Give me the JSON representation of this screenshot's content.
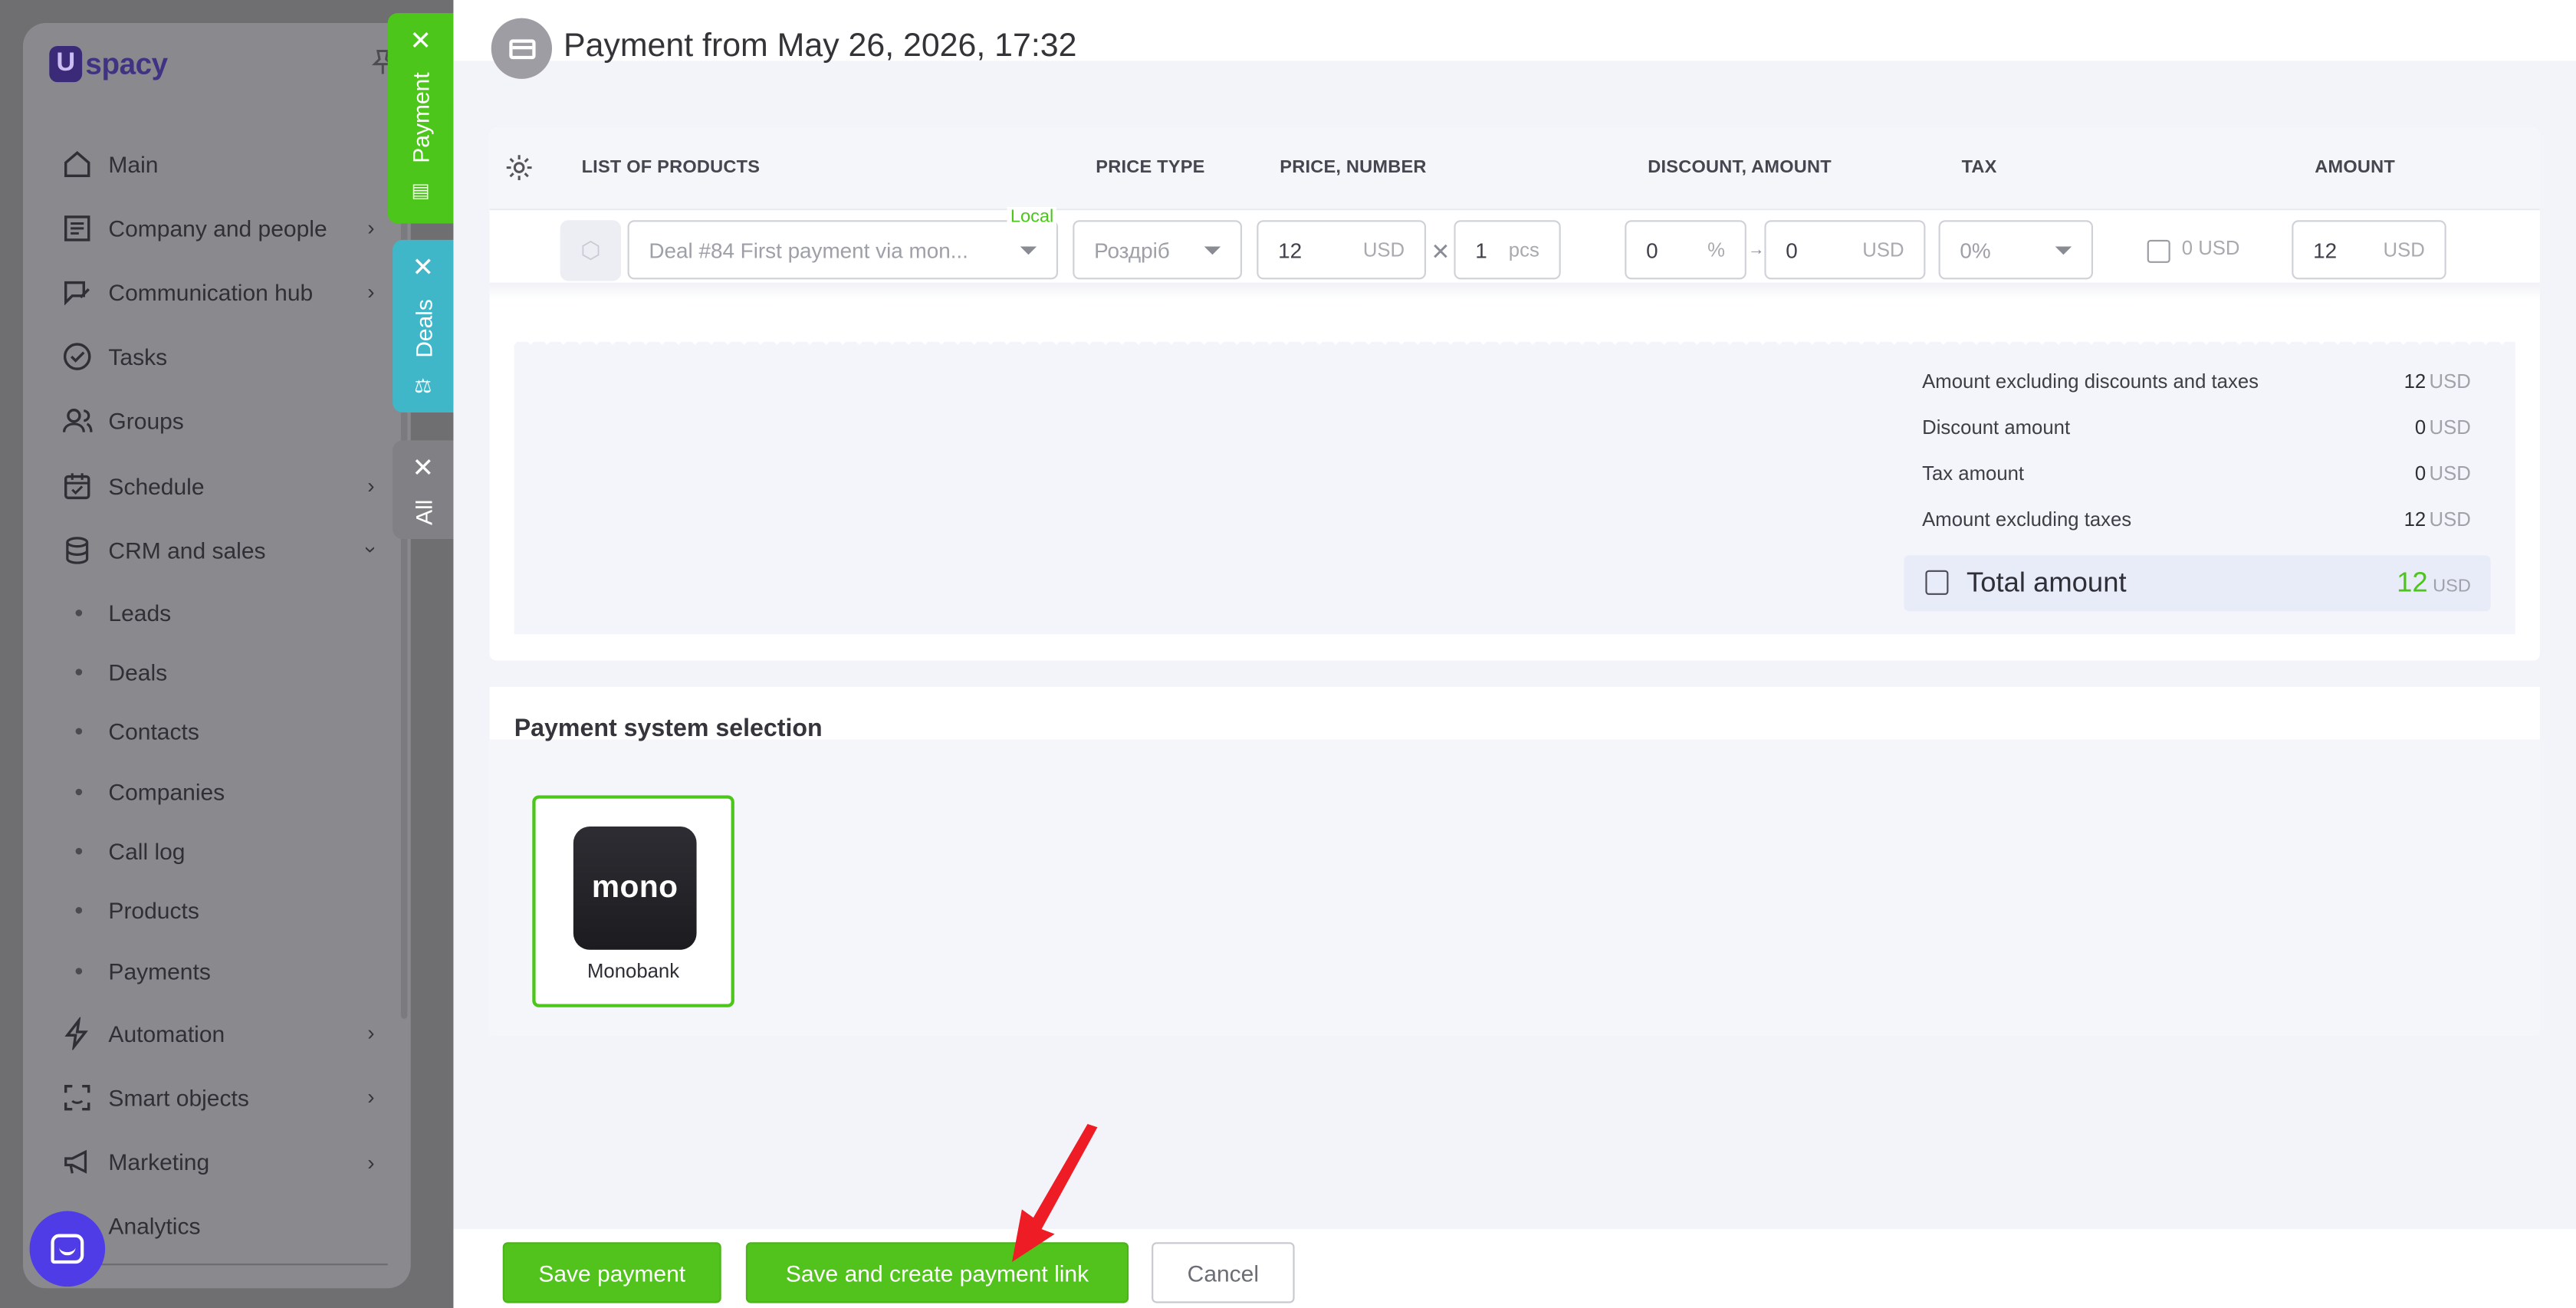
{
  "app": {
    "logo_text": "spacy",
    "logo_mark": "U"
  },
  "sidebar": {
    "items": [
      {
        "label": "Main",
        "icon": "home-icon",
        "chevron": false
      },
      {
        "label": "Company and people",
        "icon": "building-icon",
        "chevron": true
      },
      {
        "label": "Communication hub",
        "icon": "chat-edit-icon",
        "chevron": true
      },
      {
        "label": "Tasks",
        "icon": "check-circle-icon",
        "chevron": false
      },
      {
        "label": "Groups",
        "icon": "users-icon",
        "chevron": false
      },
      {
        "label": "Schedule",
        "icon": "calendar-icon",
        "chevron": true
      },
      {
        "label": "CRM and sales",
        "icon": "database-icon",
        "chevron": "down"
      }
    ],
    "crm_sub": [
      "Leads",
      "Deals",
      "Contacts",
      "Companies",
      "Call log",
      "Products",
      "Payments"
    ],
    "items_after": [
      {
        "label": "Automation",
        "icon": "lightning-icon",
        "chevron": true
      },
      {
        "label": "Smart objects",
        "icon": "scan-face-icon",
        "chevron": true
      },
      {
        "label": "Marketing",
        "icon": "megaphone-icon",
        "chevron": true
      },
      {
        "label": "Analytics",
        "icon": "chart-icon",
        "chevron": false
      }
    ]
  },
  "slider_tabs": {
    "payment": "Payment",
    "deals": "Deals",
    "all": "All"
  },
  "header": {
    "title": "Payment from May 26, 2026, 17:32"
  },
  "products_table": {
    "columns": [
      "LIST OF PRODUCTS",
      "PRICE TYPE",
      "PRICE, NUMBER",
      "DISCOUNT, AMOUNT",
      "TAX",
      "AMOUNT"
    ],
    "row": {
      "product": "Deal #84 First payment via mon...",
      "badge": "Local",
      "price_type": "Роздріб",
      "price": "12",
      "price_unit": "USD",
      "qty": "1",
      "qty_unit": "pcs",
      "discount_pct": "0",
      "discount_pct_unit": "%",
      "discount_amount": "0",
      "discount_amount_unit": "USD",
      "tax": "0%",
      "tax_amount": "0",
      "tax_unit": "USD",
      "amount": "12",
      "amount_unit": "USD"
    }
  },
  "summary": {
    "rows": [
      {
        "label": "Amount excluding discounts and taxes",
        "value": "12",
        "unit": "USD"
      },
      {
        "label": "Discount amount",
        "value": "0",
        "unit": "USD"
      },
      {
        "label": "Tax amount",
        "value": "0",
        "unit": "USD"
      },
      {
        "label": "Amount excluding taxes",
        "value": "12",
        "unit": "USD"
      }
    ],
    "total_label": "Total amount",
    "total_value": "12",
    "total_unit": "USD"
  },
  "payment_system": {
    "title": "Payment system selection",
    "option_logo": "mono",
    "option_name": "Monobank"
  },
  "footer": {
    "save": "Save payment",
    "save_link": "Save and create payment link",
    "cancel": "Cancel"
  },
  "colors": {
    "accent_green": "#52c21d",
    "deals_tab": "#3fb7c8",
    "annotation_arrow": "#ee1c25"
  }
}
